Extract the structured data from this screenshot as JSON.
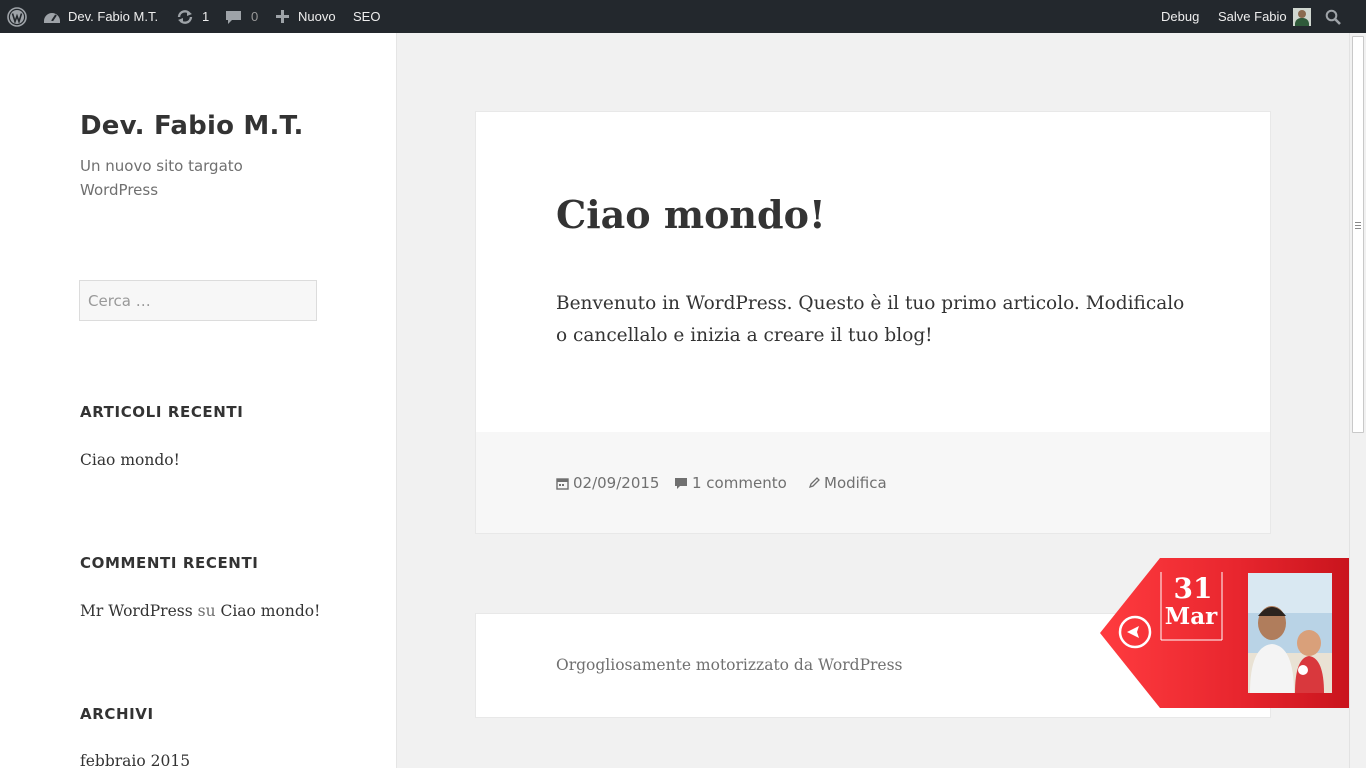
{
  "adminbar": {
    "site_name": "Dev. Fabio M.T.",
    "updates_count": "1",
    "comments_count": "0",
    "new_label": "Nuovo",
    "seo_label": "SEO",
    "debug_label": "Debug",
    "greeting": "Salve Fabio",
    "colors": {
      "background": "#23282d",
      "text": "#eeeeee"
    }
  },
  "sidebar": {
    "site_title": "Dev. Fabio M.T.",
    "site_description": "Un nuovo sito targato WordPress",
    "search_placeholder": "Cerca …",
    "recent_posts": {
      "title": "ARTICOLI RECENTI",
      "items": [
        "Ciao mondo!"
      ]
    },
    "recent_comments": {
      "title": "COMMENTI RECENTI",
      "author": "Mr WordPress",
      "connector": "su",
      "post": "Ciao mondo!"
    },
    "archives": {
      "title": "ARCHIVI",
      "items": [
        "febbraio 2015"
      ]
    }
  },
  "post": {
    "title": "Ciao mondo!",
    "content": "Benvenuto in WordPress. Questo è il tuo primo articolo. Modificalo o cancellalo e inizia a creare il tuo blog!",
    "date": "02/09/2015",
    "comments": "1 commento",
    "edit": "Modifica"
  },
  "footer": {
    "credit": "Orgogliosamente motorizzato da WordPress"
  },
  "date_badge": {
    "day": "31",
    "month": "Mar",
    "colors": {
      "accent": "#e8262e",
      "dark": "#c9141d"
    },
    "icon": "back-arrow-icon"
  }
}
